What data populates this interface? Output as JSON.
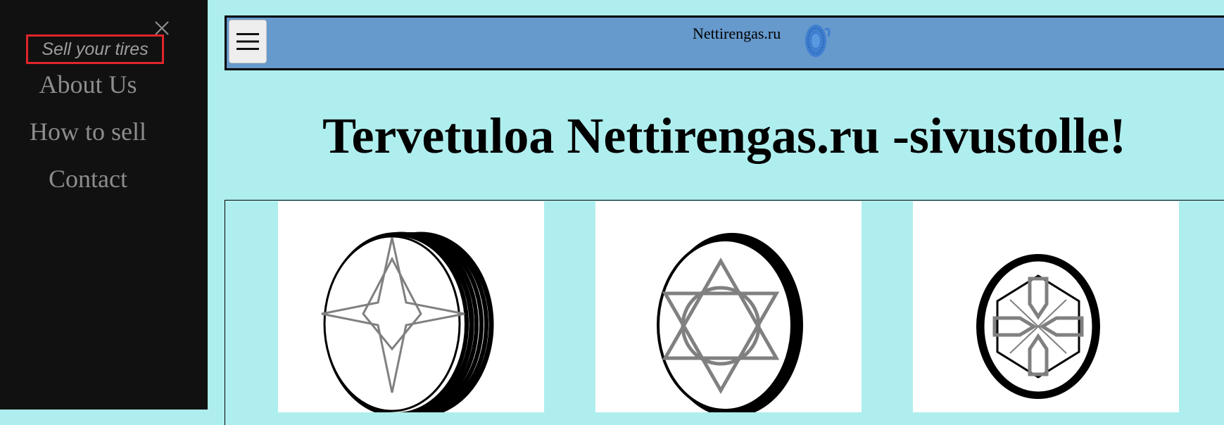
{
  "sidebar": {
    "close_icon": "close-icon",
    "sell_label": "Sell your tires",
    "items": [
      {
        "label": "About Us"
      },
      {
        "label": "How to sell"
      },
      {
        "label": "Contact"
      }
    ]
  },
  "header": {
    "menu_icon": "hamburger-menu-icon",
    "brand": "Nettirengas.ru",
    "logo_icon": "tire-logo-icon"
  },
  "main": {
    "title": "Tervetuloa Nettirengas.ru -sivustolle!",
    "gallery": [
      {
        "icon": "tire-compass-star-icon"
      },
      {
        "icon": "tire-hexagram-icon"
      },
      {
        "icon": "tire-hexagon-arrows-icon"
      }
    ]
  },
  "colors": {
    "page_background": "#afeeee",
    "sidebar_background": "#111111",
    "header_background": "#6699cc",
    "highlight_border": "#e0252a",
    "sidebar_text": "#8d8d8d"
  }
}
